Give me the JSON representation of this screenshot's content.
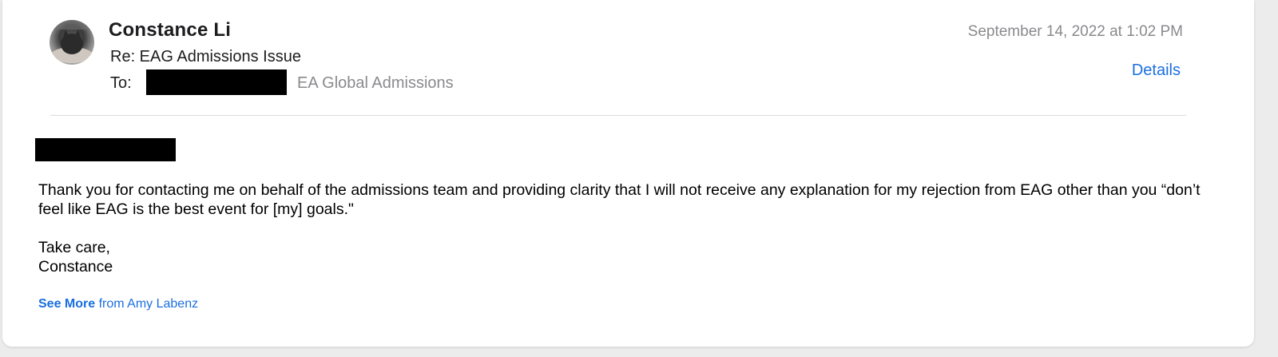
{
  "message": {
    "sender_name": "Constance Li",
    "subject": "Re: EAG Admissions Issue",
    "to_label": "To:",
    "to_name": "EA Global Admissions",
    "date": "September 14, 2022 at 1:02 PM",
    "details_label": "Details"
  },
  "body": {
    "paragraph": "Thank you for contacting me on behalf of the admissions team and providing clarity that I will not receive any explanation for my rejection from EAG other than you “don’t feel like EAG is the best event for [my] goals.\"",
    "signoff": "Take care,",
    "signature": "Constance"
  },
  "see_more": {
    "link_label": "See More",
    "suffix": "from Amy Labenz"
  },
  "colors": {
    "accent": "#1a6fe0",
    "secondary_text": "#8a8a8e",
    "redaction": "#000000"
  }
}
